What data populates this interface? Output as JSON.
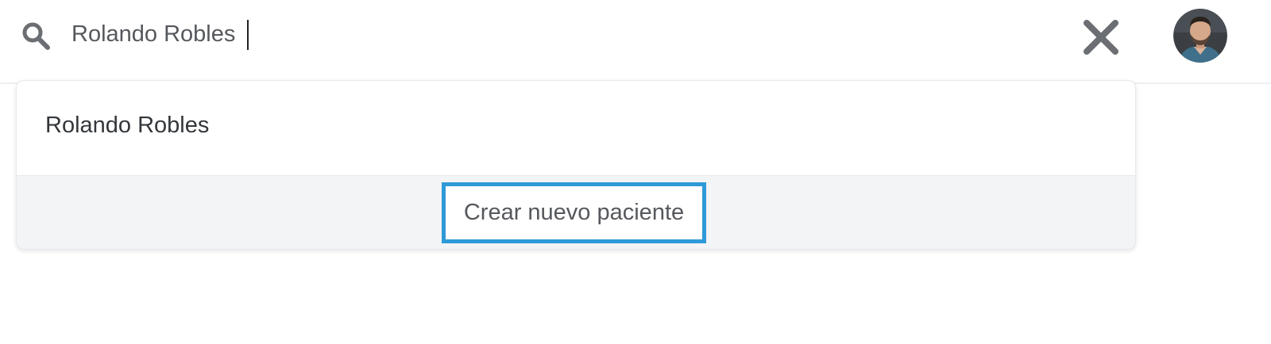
{
  "search": {
    "value": "Rolando Robles",
    "icon": "search-icon"
  },
  "header": {
    "clear_icon": "close-icon",
    "avatar_icon": "user-avatar"
  },
  "dropdown": {
    "results": [
      {
        "label": "Rolando Robles"
      }
    ],
    "create_label": "Crear nuevo paciente"
  },
  "colors": {
    "highlight_border": "#2f9ad8",
    "icon_gray": "#6b6e72",
    "text_dark": "#33373b",
    "footer_bg": "#f3f4f6"
  }
}
